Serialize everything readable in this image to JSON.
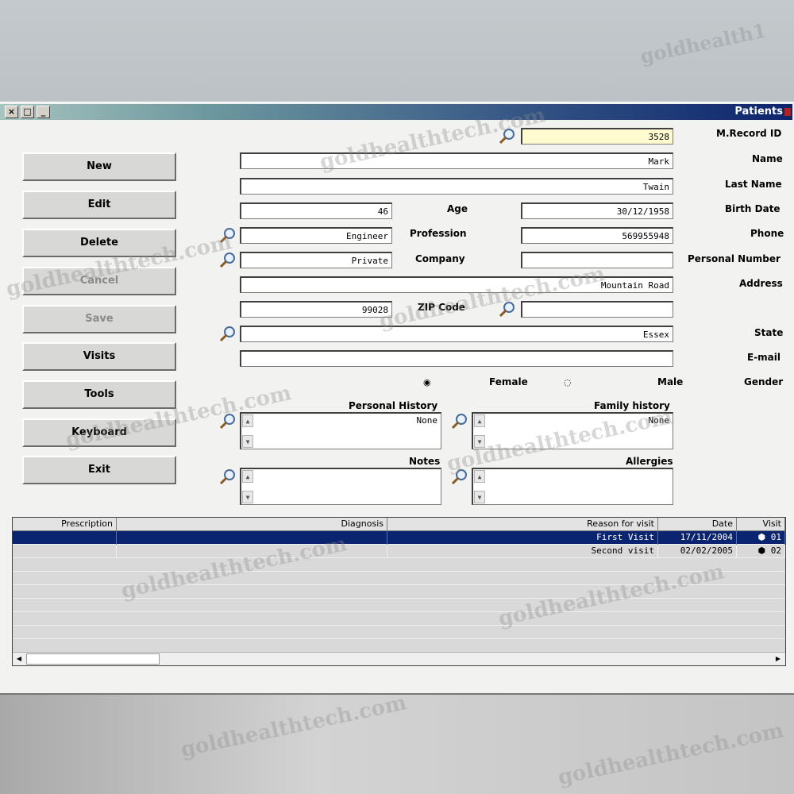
{
  "window": {
    "title": "Patients",
    "controls": {
      "close": "×",
      "restore": "□",
      "minimize": "_"
    }
  },
  "form": {
    "record_id": {
      "label": "M.Record ID",
      "value": "3528"
    },
    "name": {
      "label": "Name",
      "value": "Mark"
    },
    "last_name": {
      "label": "Last Name",
      "value": "Twain"
    },
    "birth_date": {
      "label": "Birth Date",
      "value": "30/12/1958"
    },
    "age": {
      "label": "Age",
      "value": "46"
    },
    "phone": {
      "label": "Phone",
      "value": "569955948"
    },
    "profession": {
      "label": "Profession",
      "value": "Engineer"
    },
    "personal_number": {
      "label": "Personal Number",
      "value": ""
    },
    "company": {
      "label": "Company",
      "value": "Private"
    },
    "address": {
      "label": "Address",
      "value": "Mountain Road"
    },
    "zip_code": {
      "label": "ZIP Code",
      "value": "99028"
    },
    "zip_extra": {
      "value": ""
    },
    "state": {
      "label": "State",
      "value": "Essex"
    },
    "email": {
      "label": "E-mail",
      "value": ""
    },
    "gender": {
      "label": "Gender",
      "male": "Male",
      "female": "Female",
      "selected": "Male"
    },
    "family_history": {
      "label": "Family history",
      "value": "None"
    },
    "personal_history": {
      "label": "Personal History",
      "value": "None"
    },
    "allergies": {
      "label": "Allergies",
      "value": ""
    },
    "notes": {
      "label": "Notes",
      "value": ""
    }
  },
  "buttons": [
    {
      "label": "New",
      "enabled": true
    },
    {
      "label": "Edit",
      "enabled": true
    },
    {
      "label": "Delete",
      "enabled": true
    },
    {
      "label": "Cancel",
      "enabled": false
    },
    {
      "label": "Save",
      "enabled": false
    },
    {
      "label": "Visits",
      "enabled": true
    },
    {
      "label": "Tools",
      "enabled": true
    },
    {
      "label": "Keyboard",
      "enabled": true
    },
    {
      "label": "Exit",
      "enabled": true
    }
  ],
  "visits_table": {
    "columns": [
      "Visit",
      "Date",
      "Reason for visit",
      "Diagnosis",
      "Prescription"
    ],
    "rows": [
      {
        "visit": "01",
        "date": "17/11/2004",
        "reason": "First Visit",
        "diagnosis": "",
        "prescription": "",
        "selected": true
      },
      {
        "visit": "02",
        "date": "02/02/2005",
        "reason": "Second visit",
        "diagnosis": "",
        "prescription": "",
        "selected": false
      }
    ]
  },
  "watermark": "goldhealthtech.com",
  "colors": {
    "titlebar_dark": "#0c246c",
    "selected_row": "#0b2470",
    "record_id_bg": "#fffbd1"
  }
}
